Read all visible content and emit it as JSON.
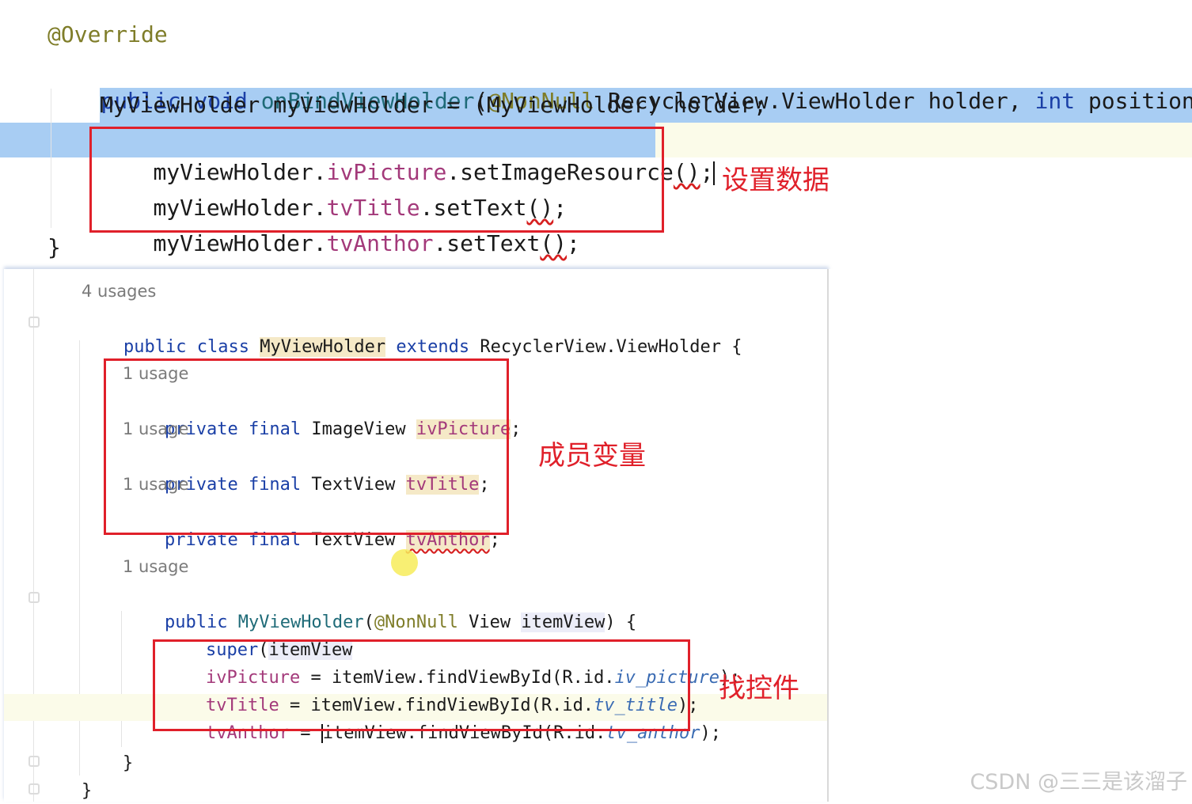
{
  "top_code": {
    "annotation": "@Override",
    "sig": {
      "kw_public": "public",
      "kw_void": "void",
      "method": "onBindViewHolder",
      "open": "(",
      "ann_nonnull": "@NonNull",
      "type": " RecyclerView.ViewHolder holder, ",
      "kw_int": "int",
      "tail": " position) {"
    },
    "line_cast": "MyViewHolder myViewHolder = (MyViewHolder) holder;",
    "line_picture": {
      "obj": "myViewHolder.",
      "field": "ivPicture",
      "call": ".setImageResource",
      "args": "()",
      "end": ";"
    },
    "line_title": {
      "obj": "myViewHolder.",
      "field": "tvTitle",
      "call": ".setText",
      "args": "()",
      "end": ";"
    },
    "line_anthor": {
      "obj": "myViewHolder.",
      "field": "tvAnthor",
      "call": ".setText",
      "args": "()",
      "end": ";"
    },
    "close": "}"
  },
  "bottom_code": {
    "class_usages": "4 usages",
    "class_decl": {
      "kw_public": "public",
      "kw_class": "class",
      "name": "MyViewHolder",
      "kw_extends": "extends",
      "parent": "RecyclerView.ViewHolder {"
    },
    "fields": [
      {
        "usage": "1 usage",
        "kw": "private final",
        "type": "ImageView",
        "name": "ivPicture"
      },
      {
        "usage": "1 usage",
        "kw": "private final",
        "type": "TextView",
        "name": "tvTitle"
      },
      {
        "usage": "1 usage",
        "kw": "private final",
        "type": "TextView",
        "name": "tvAnthor"
      }
    ],
    "ctor_usage": "1 usage",
    "ctor": {
      "kw_public": "public",
      "name": "MyViewHolder",
      "open": "(",
      "ann": "@NonNull",
      "type": " View ",
      "param": "itemView",
      "tail": ") {"
    },
    "super_line": {
      "kw": "super",
      "open": "(",
      "arg": "itemView",
      "tail": ");"
    },
    "finds": [
      {
        "field": "ivPicture",
        "mid": " = itemView.findViewById(R.id.",
        "res": "iv_picture",
        "end": ");"
      },
      {
        "field": "tvTitle",
        "mid": " = itemView.findViewById(R.id.",
        "res": "tv_title",
        "end": ");"
      },
      {
        "field": "tvAnthor",
        "eq": " = ",
        "mid": "itemView.findViewById(R.id.",
        "res": "tv_anthor",
        "end": ");"
      }
    ],
    "close_inner": "}",
    "close_outer": "}"
  },
  "notes": {
    "set_data": "设置数据",
    "member_vars": "成员变量",
    "find_views": "找控件"
  },
  "watermark": "CSDN @三三是该溜子",
  "colors": {
    "keyword": "#1a3fa6",
    "annotation": "#7f7d29",
    "field": "#a3397a",
    "method": "#1f6b78",
    "selection": "#a8cdf3",
    "red_box": "#e0202a"
  }
}
